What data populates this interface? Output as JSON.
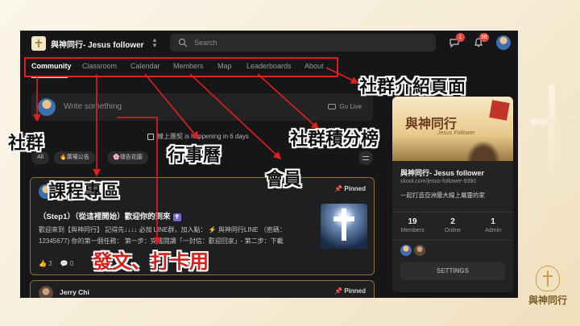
{
  "app": {
    "group_name": "與神同行- Jesus follower",
    "search_placeholder": "Search",
    "chat_badge": "1",
    "notif_badge": "36"
  },
  "nav": {
    "tabs": [
      {
        "label": "Community"
      },
      {
        "label": "Classroom"
      },
      {
        "label": "Calendar"
      },
      {
        "label": "Members"
      },
      {
        "label": "Map"
      },
      {
        "label": "Leaderboards"
      },
      {
        "label": "About"
      }
    ]
  },
  "composer": {
    "placeholder": "Write something",
    "golive": "Go Live"
  },
  "event": {
    "text": "線上團契 is happening in 6 days"
  },
  "chips": {
    "all": "All",
    "c1": "🔥廣場公告",
    "c2": "🌸禱告花園"
  },
  "post": {
    "pinned": "Pinned",
    "title": "（Step1）（從這裡開始）歡迎你的到來",
    "body": "歡迎來到【與神同行】 記得先↓↓↓↓ 必加 LINE群，加入點： ⚡ 與神同行LINE （密碼：12345677) 你的第一個任務： 第一步：完成閱讀「一封信：歡迎回家」- 第二步：下載",
    "likes": "3",
    "comments": "0"
  },
  "post2": {
    "author": "Jerry Chi",
    "pinned": "Pinned"
  },
  "sidebar": {
    "cover_title": "與神同行",
    "cover_sub": "Jesus Follower",
    "name": "與神同行- Jesus follower",
    "url": "skool.com/jesus-follower-9390",
    "desc": "一起打造亞洲最大線上屬靈的家",
    "stats": [
      {
        "num": "19",
        "label": "Members"
      },
      {
        "num": "2",
        "label": "Online"
      },
      {
        "num": "1",
        "label": "Admin"
      }
    ],
    "settings": "SETTINGS"
  },
  "annotations": {
    "about": "社群介紹頁面",
    "community": "社群",
    "leaderboards": "社群積分榜",
    "calendar": "行事曆",
    "classroom": "課程專區",
    "members": "會員",
    "post": "發文、打卡用"
  },
  "brand": {
    "text": "與神同行"
  },
  "colors": {
    "accent_red": "#d81d16",
    "pinned_border": "#8a7435",
    "screen_bg": "#161618"
  }
}
